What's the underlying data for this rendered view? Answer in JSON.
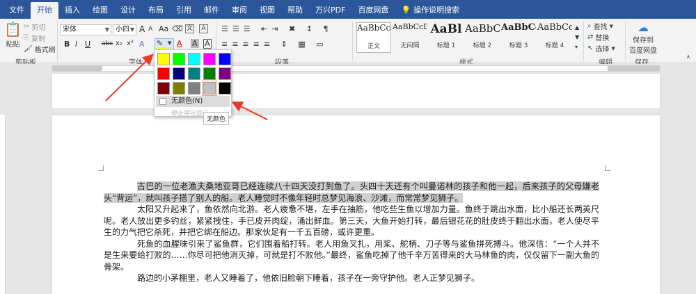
{
  "tabs": [
    {
      "label": "文件"
    },
    {
      "label": "开始",
      "active": true
    },
    {
      "label": "插入"
    },
    {
      "label": "绘图"
    },
    {
      "label": "设计"
    },
    {
      "label": "布局"
    },
    {
      "label": "引用"
    },
    {
      "label": "邮件"
    },
    {
      "label": "审阅"
    },
    {
      "label": "视图"
    },
    {
      "label": "帮助"
    },
    {
      "label": "万兴PDF"
    },
    {
      "label": "百度网盘"
    }
  ],
  "tell_me": "操作说明搜索",
  "clipboard": {
    "paste": "粘贴",
    "cut": "剪切",
    "copy": "复制",
    "format_painter": "格式刷",
    "group": "剪贴板"
  },
  "font": {
    "name": "宋体",
    "size": "小四",
    "group": "字体",
    "grow": "A",
    "shrink": "A",
    "case": "Aa",
    "bold": "B",
    "italic": "I",
    "underline": "U",
    "strike": "abc",
    "sub": "x₂",
    "sup": "x²",
    "effects": "A",
    "color": "A",
    "char_shade": "A",
    "border": "A"
  },
  "paragraph": {
    "group": "段落"
  },
  "styles": {
    "group": "样式",
    "items": [
      {
        "sample": "AaBbCcDc",
        "name": "正文"
      },
      {
        "sample": "AaBbCcDc",
        "name": "无间隔"
      },
      {
        "sample": "AaBl",
        "name": "标题 1"
      },
      {
        "sample": "AaBbC",
        "name": "标题 2"
      },
      {
        "sample": "AaBbCc",
        "name": "标题 3"
      },
      {
        "sample": "AaBbCc",
        "name": "标题 4"
      }
    ]
  },
  "editing": {
    "find": "查找",
    "replace": "替换",
    "select": "选择",
    "group": "编辑"
  },
  "save": {
    "label1": "保存到",
    "label2": "百度网盘",
    "group": "保存"
  },
  "picker": {
    "colors": [
      "#ffff00",
      "#00ff00",
      "#00ffff",
      "#ff00ff",
      "#0000ff",
      "#ff0000",
      "#000080",
      "#008080",
      "#008000",
      "#800080",
      "#800000",
      "#808000",
      "#808080",
      "#c0c0c0",
      "#000000"
    ],
    "no_color": "无颜色(N)",
    "stop": "停止突出显示",
    "tooltip": "无颜色"
  },
  "document": {
    "paragraphs": [
      {
        "hl": "古巴的一位老渔夫桑地亚哥已经连续八十四天没打到鱼了。头四十天还有个叫曼诺林的孩子和他一起，后来孩子的父母嫌老头“背运”，就叫孩子搭了别人的船。老人睡觉时不像年轻时总梦见海浪、沙滩，而常常梦见狮子。",
        "rest": ""
      },
      {
        "hl": "",
        "rest": "太阳又升起来了，鱼依然向北游。老人疲惫不堪，左手在抽筋，他吃些生鱼以增加力量。鱼终于跳出水面，比小船还长两英尺呢。老人放出更多钓丝，紧紧拽住，手已皮开肉绽，涌出鲜血。第三天，大鱼开始打转，最后银花花的肚皮终于翻出水面，老人使尽平生的力气把它杀死，并把它绑在船边。那家伙足有一千五百磅，或许更重。"
      },
      {
        "hl": "",
        "rest": "死鱼的血腥味引来了鲨鱼群，它们围着船打转。老人用鱼叉扎，用桨、舵柄、刀子等与鲨鱼拼死搏斗。他深信：“一个人并不是生来要给打败的……你尽可把他消灭掉，可就是打不败他。”最终，鲨鱼吃掉了他千辛万苦得来的大马林鱼的肉，仅仅留下一副大鱼的骨架。"
      },
      {
        "hl": "",
        "rest": "路边的小茅棚里，老人又睡着了，他依旧脸朝下睡着，孩子在一旁守护他。老人正梦见狮子。"
      }
    ]
  },
  "accent_color": "#2b579a",
  "arrow_color": "#e8392b"
}
